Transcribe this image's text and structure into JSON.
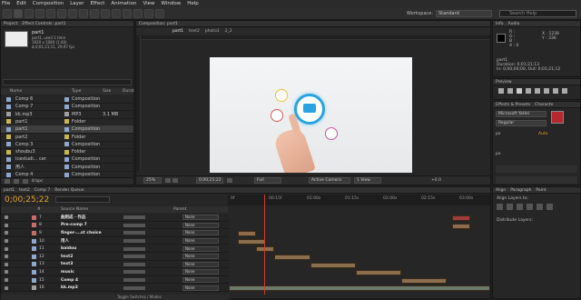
{
  "menu": [
    "File",
    "Edit",
    "Composition",
    "Layer",
    "Effect",
    "Animation",
    "View",
    "Window",
    "Help"
  ],
  "workspace": {
    "label": "Workspace:",
    "value": "Standard"
  },
  "search_help": "Search Help",
  "project": {
    "tabs": [
      "Project",
      "Effect Controls: part1"
    ],
    "thumb_name": "part1",
    "thumb_info": [
      "part1, used 1 time",
      "1920 x 1080 (1.00)",
      "Δ 0;01;21;11, 29.97 fps"
    ],
    "columns": [
      "Name",
      "Type",
      "Size",
      "Durat"
    ],
    "items": [
      {
        "name": "Comp 6",
        "type": "Composition",
        "size": "",
        "color": "#8ea7cc"
      },
      {
        "name": "Comp 7",
        "type": "Composition",
        "size": "",
        "color": "#8ea7cc"
      },
      {
        "name": "kk.mp3",
        "type": "MP3",
        "size": "3.1 MB",
        "color": "#a0a0a0"
      },
      {
        "name": "part1",
        "type": "Folder",
        "size": "",
        "color": "#c9b553"
      },
      {
        "name": "part1",
        "type": "Composition",
        "size": "",
        "color": "#8ea7cc"
      },
      {
        "name": "part2",
        "type": "Folder",
        "size": "",
        "color": "#c9b553"
      },
      {
        "name": "Comp 3",
        "type": "Composition",
        "size": "",
        "color": "#8ea7cc"
      },
      {
        "name": "shoubu3",
        "type": "Folder",
        "size": "",
        "color": "#c9b553"
      },
      {
        "name": "Icestudi... cer",
        "type": "Composition",
        "size": "",
        "color": "#8ea7cc"
      },
      {
        "name": "用人",
        "type": "Composition",
        "size": "",
        "color": "#8ea7cc"
      },
      {
        "name": "Comp 4",
        "type": "Composition",
        "size": "",
        "color": "#8ea7cc"
      }
    ],
    "bpc": "8 bpc"
  },
  "composition": {
    "tab": "Composition: part1",
    "breadcrumbs": [
      "part1",
      "text2",
      "photo1",
      "2_2"
    ],
    "zoom": "25%",
    "timecode": "0;00;25;22",
    "resolution": "Full",
    "camera": "Active Camera",
    "views": "1 View",
    "offset": "+0.0"
  },
  "info": {
    "tabs": [
      "Info",
      "Audio"
    ],
    "rgb": [
      "R :",
      "G :",
      "B :",
      "A : 0"
    ],
    "coords": [
      "X : 1238",
      "Y : 336"
    ],
    "title": "part1",
    "lines": [
      "Duration: 0;01;21;13",
      "In: 0;00;00;00, Out: 0;01;21;12"
    ]
  },
  "preview": {
    "tab": "Preview"
  },
  "effects": {
    "tabs": [
      "Effects & Presets",
      "Characte"
    ],
    "font": "Microsoft YaHei",
    "style": "Regular",
    "size": "px",
    "tracking": "Auto",
    "unit": "px"
  },
  "timeline": {
    "tabs": [
      "part1",
      "text2",
      "Comp 7",
      "Render Queue"
    ],
    "timecode": "0;00;25;22",
    "columns": [
      "#",
      "Source Name",
      "Parent"
    ],
    "ruler": [
      "0f",
      "00:15f",
      "01:00s",
      "01:15s",
      "02:00s",
      "02:15s",
      "03:00s"
    ],
    "layers": [
      {
        "num": "7",
        "name": "曲则成 · 作品",
        "parent": "None",
        "label": "#c76b6b"
      },
      {
        "num": "8",
        "name": "Pre-comp 7",
        "parent": "None",
        "label": "#c76b6b"
      },
      {
        "num": "9",
        "name": "finger-...st choice",
        "parent": "None",
        "label": "#c76b6b"
      },
      {
        "num": "10",
        "name": "用人",
        "parent": "None",
        "label": "#8ea7cc"
      },
      {
        "num": "11",
        "name": "baidou",
        "parent": "None",
        "label": "#8ea7cc"
      },
      {
        "num": "12",
        "name": "text2",
        "parent": "None",
        "label": "#8ea7cc"
      },
      {
        "num": "13",
        "name": "text3",
        "parent": "None",
        "label": "#8ea7cc"
      },
      {
        "num": "14",
        "name": "music",
        "parent": "None",
        "label": "#8ea7cc"
      },
      {
        "num": "15",
        "name": "Comp 4",
        "parent": "None",
        "label": "#8ea7cc"
      },
      {
        "num": "16",
        "name": "kk.mp3",
        "parent": "None",
        "label": "#a0a0a0"
      }
    ],
    "toggle": "Toggle Switches / Modes"
  },
  "align": {
    "tabs": [
      "Align",
      "Paragraph",
      "Paint"
    ],
    "align_to": "Align Layers to:",
    "distribute": "Distribute Layers:"
  }
}
